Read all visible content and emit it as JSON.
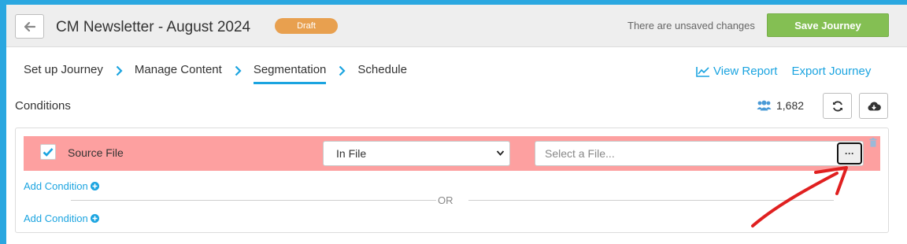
{
  "header": {
    "title": "CM Newsletter - August 2024",
    "badge": "Draft",
    "unsaved": "There are unsaved changes",
    "save_label": "Save Journey"
  },
  "steps": [
    {
      "label": "Set up Journey"
    },
    {
      "label": "Manage Content"
    },
    {
      "label": "Segmentation"
    },
    {
      "label": "Schedule"
    }
  ],
  "links": {
    "view_report": "View Report",
    "export_journey": "Export Journey"
  },
  "conditions": {
    "label": "Conditions",
    "count": "1,682",
    "row": {
      "checked": true,
      "field": "Source File",
      "operator": "In File",
      "file_placeholder": "Select a File...",
      "browse_label": "···"
    },
    "add_condition": "Add Condition",
    "or_label": "OR"
  },
  "colors": {
    "accent": "#1ba4e0",
    "save": "#84bf53",
    "draft": "#e8a04f",
    "row_highlight": "#fda0a0",
    "annotation": "#e02020"
  },
  "icons": [
    "back-arrow-icon",
    "chevron-right-icon",
    "chart-line-icon",
    "users-icon",
    "refresh-icon",
    "cloud-download-icon",
    "check-icon",
    "caret-down-icon",
    "trash-icon",
    "plus-circle-icon"
  ]
}
